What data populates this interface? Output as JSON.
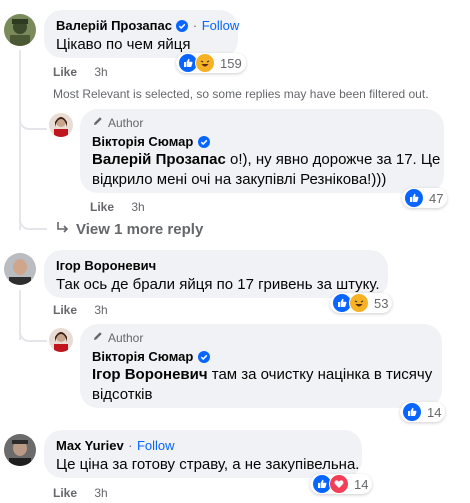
{
  "comments": [
    {
      "name": "Валерій Прозапас",
      "follow": "Follow",
      "text": "Цікаво по чем яйця",
      "like": "Like",
      "time": "3h",
      "reactions_count": "159"
    },
    {
      "author_label": "Author",
      "name": "Вікторія Сюмар",
      "mention": "Валерій Прозапас",
      "text_line1": " о!), ну явно дорожче за 17. Це",
      "text_line2": "відкрило мені очі на закупівлі Резнікова!)))",
      "like": "Like",
      "time": "3h",
      "reactions_count": "47"
    },
    {
      "name": "Ігор Вороневич",
      "text": "Так ось де брали яйця по 17 гривень за штуку.",
      "like": "Like",
      "time": "3h",
      "reactions_count": "53"
    },
    {
      "author_label": "Author",
      "name": "Вікторія Сюмар",
      "mention": "Ігор Вороневич",
      "text_line1": " там за очистку націнка в тисячу",
      "text_line2": "відсотків",
      "like": "Like",
      "time": "3h",
      "reactions_count": "14"
    },
    {
      "name": "Max Yuriev",
      "follow": "Follow",
      "text": "Це ціна за готову страву, а не закупівельна.",
      "like": "Like",
      "time": "3h",
      "reactions_count": "14"
    }
  ],
  "filter_notice": "Most Relevant is selected, so some replies may have been filtered out.",
  "view_more": "View 1 more reply",
  "dot": "·",
  "colors": {
    "like_blue": "#0866ff",
    "haha_yellow": "#f7b125",
    "love_red": "#f33e58",
    "bubble_bg": "#f0f2f5",
    "meta_gray": "#65676b"
  },
  "icons": [
    "like-reaction-icon",
    "haha-reaction-icon",
    "love-reaction-icon",
    "verified-badge-icon",
    "pencil-icon",
    "reply-arrow-icon"
  ]
}
